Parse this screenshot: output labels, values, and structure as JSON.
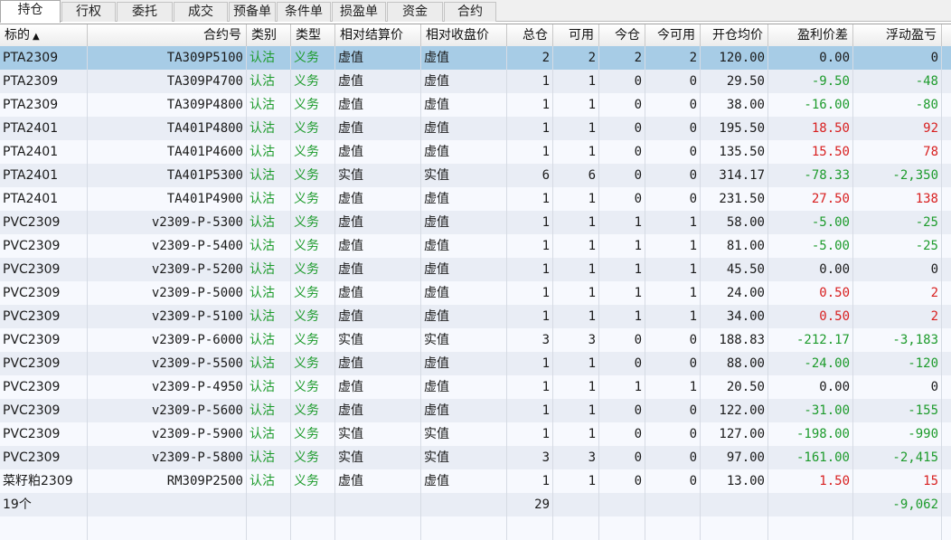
{
  "tabs": [
    "持仓",
    "行权",
    "委托",
    "成交",
    "预备单",
    "条件单",
    "损盈单",
    "资金",
    "合约"
  ],
  "active_tab": 0,
  "columns": [
    "标的",
    "合约号",
    "类别",
    "类型",
    "相对结算价",
    "相对收盘价",
    "总仓",
    "可用",
    "今仓",
    "今可用",
    "开仓均价",
    "盈利价差",
    "浮动盈亏"
  ],
  "sort_indicator": "▲",
  "colors": {
    "profit": "#d81f1f",
    "loss": "#1d9b2c",
    "selected_row": "#a7cce6",
    "green_text": "#1d9b2c"
  },
  "rows": [
    [
      "PTA2309",
      "TA309P5100",
      "认沽",
      "义务",
      "虚值",
      "虚值",
      "2",
      "2",
      "2",
      "2",
      "120.00",
      "0.00",
      "0"
    ],
    [
      "PTA2309",
      "TA309P4700",
      "认沽",
      "义务",
      "虚值",
      "虚值",
      "1",
      "1",
      "0",
      "0",
      "29.50",
      "-9.50",
      "-48"
    ],
    [
      "PTA2309",
      "TA309P4800",
      "认沽",
      "义务",
      "虚值",
      "虚值",
      "1",
      "1",
      "0",
      "0",
      "38.00",
      "-16.00",
      "-80"
    ],
    [
      "PTA2401",
      "TA401P4800",
      "认沽",
      "义务",
      "虚值",
      "虚值",
      "1",
      "1",
      "0",
      "0",
      "195.50",
      "18.50",
      "92"
    ],
    [
      "PTA2401",
      "TA401P4600",
      "认沽",
      "义务",
      "虚值",
      "虚值",
      "1",
      "1",
      "0",
      "0",
      "135.50",
      "15.50",
      "78"
    ],
    [
      "PTA2401",
      "TA401P5300",
      "认沽",
      "义务",
      "实值",
      "实值",
      "6",
      "6",
      "0",
      "0",
      "314.17",
      "-78.33",
      "-2,350"
    ],
    [
      "PTA2401",
      "TA401P4900",
      "认沽",
      "义务",
      "虚值",
      "虚值",
      "1",
      "1",
      "0",
      "0",
      "231.50",
      "27.50",
      "138"
    ],
    [
      "PVC2309",
      "v2309-P-5300",
      "认沽",
      "义务",
      "虚值",
      "虚值",
      "1",
      "1",
      "1",
      "1",
      "58.00",
      "-5.00",
      "-25"
    ],
    [
      "PVC2309",
      "v2309-P-5400",
      "认沽",
      "义务",
      "虚值",
      "虚值",
      "1",
      "1",
      "1",
      "1",
      "81.00",
      "-5.00",
      "-25"
    ],
    [
      "PVC2309",
      "v2309-P-5200",
      "认沽",
      "义务",
      "虚值",
      "虚值",
      "1",
      "1",
      "1",
      "1",
      "45.50",
      "0.00",
      "0"
    ],
    [
      "PVC2309",
      "v2309-P-5000",
      "认沽",
      "义务",
      "虚值",
      "虚值",
      "1",
      "1",
      "1",
      "1",
      "24.00",
      "0.50",
      "2"
    ],
    [
      "PVC2309",
      "v2309-P-5100",
      "认沽",
      "义务",
      "虚值",
      "虚值",
      "1",
      "1",
      "1",
      "1",
      "34.00",
      "0.50",
      "2"
    ],
    [
      "PVC2309",
      "v2309-P-6000",
      "认沽",
      "义务",
      "实值",
      "实值",
      "3",
      "3",
      "0",
      "0",
      "188.83",
      "-212.17",
      "-3,183"
    ],
    [
      "PVC2309",
      "v2309-P-5500",
      "认沽",
      "义务",
      "虚值",
      "虚值",
      "1",
      "1",
      "0",
      "0",
      "88.00",
      "-24.00",
      "-120"
    ],
    [
      "PVC2309",
      "v2309-P-4950",
      "认沽",
      "义务",
      "虚值",
      "虚值",
      "1",
      "1",
      "1",
      "1",
      "20.50",
      "0.00",
      "0"
    ],
    [
      "PVC2309",
      "v2309-P-5600",
      "认沽",
      "义务",
      "虚值",
      "虚值",
      "1",
      "1",
      "0",
      "0",
      "122.00",
      "-31.00",
      "-155"
    ],
    [
      "PVC2309",
      "v2309-P-5900",
      "认沽",
      "义务",
      "实值",
      "实值",
      "1",
      "1",
      "0",
      "0",
      "127.00",
      "-198.00",
      "-990"
    ],
    [
      "PVC2309",
      "v2309-P-5800",
      "认沽",
      "义务",
      "实值",
      "实值",
      "3",
      "3",
      "0",
      "0",
      "97.00",
      "-161.00",
      "-2,415"
    ],
    [
      "菜籽粕2309",
      "RM309P2500",
      "认沽",
      "义务",
      "虚值",
      "虚值",
      "1",
      "1",
      "0",
      "0",
      "13.00",
      "1.50",
      "15"
    ]
  ],
  "selected_row": 0,
  "total": {
    "count_label": "19个",
    "total_position": "29",
    "floating_pnl": "-9,062"
  }
}
